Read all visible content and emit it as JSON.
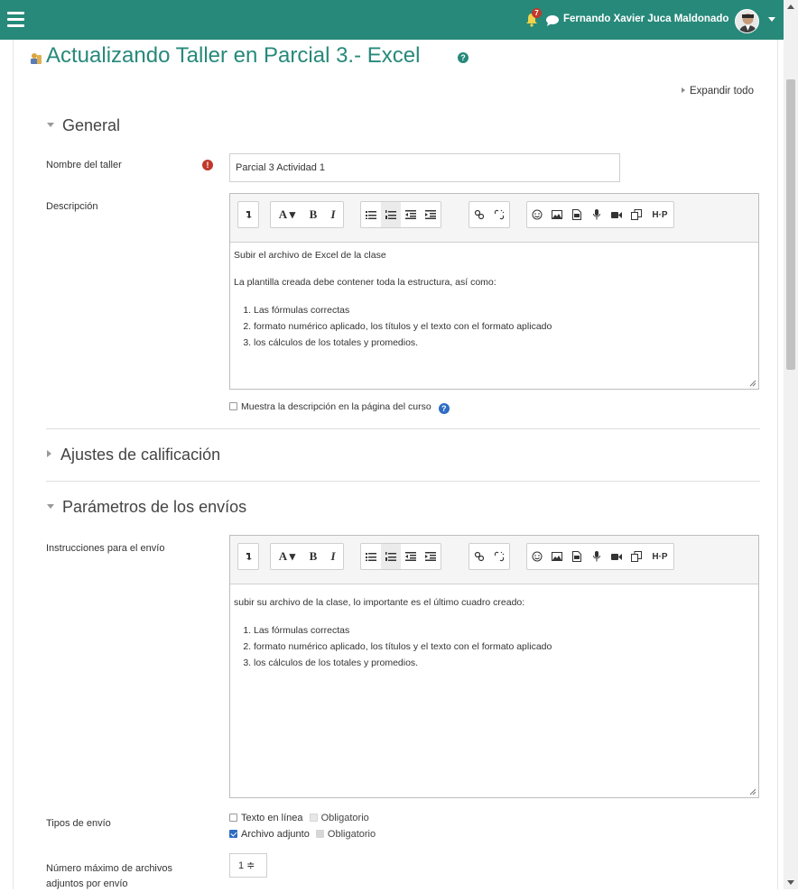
{
  "topbar": {
    "notification_count": "7",
    "user_name": "Fernando Xavier Juca Maldonado",
    "bg_color": "#27897a"
  },
  "page": {
    "title": "Actualizando Taller en Parcial 3.- Excel",
    "expand_all": "Expandir todo"
  },
  "general": {
    "heading": "General",
    "name_label": "Nombre del taller",
    "name_value": "Parcial 3 Actividad 1",
    "description_label": "Descripción",
    "description_intro": "Subir el archivo de Excel de la clase",
    "description_lead": "La plantilla creada debe contener toda la estructura, así como:",
    "description_items": [
      "Las fórmulas correctas",
      "formato numérico aplicado, los títulos y el texto con el formato aplicado",
      "los cálculos de los totales y promedios."
    ],
    "show_description_label": "Muestra la descripción en la página del curso"
  },
  "grading": {
    "heading": "Ajustes de calificación"
  },
  "submission": {
    "heading": "Parámetros de los envíos",
    "instructions_label": "Instrucciones para el envío",
    "instructions_lead": "subir su archivo de la clase, lo importante es el último cuadro creado:",
    "instructions_items": [
      "Las fórmulas correctas",
      "formato numérico aplicado, los títulos y el texto con el formato aplicado",
      "los cálculos de los totales y promedios."
    ],
    "types_label": "Tipos de envío",
    "online_text": "Texto en línea",
    "required_1": "Obligatorio",
    "attachment": "Archivo adjunto",
    "required_2": "Obligatorio",
    "max_files_label_1": "Número máximo de archivos",
    "max_files_label_2": "adjuntos por envío",
    "max_files_value": "1 ≑"
  },
  "editor_toolbar": {
    "font_btn": "A ▾",
    "bold_btn": "B",
    "italic_btn": "I",
    "h5p_btn": "H·P"
  }
}
